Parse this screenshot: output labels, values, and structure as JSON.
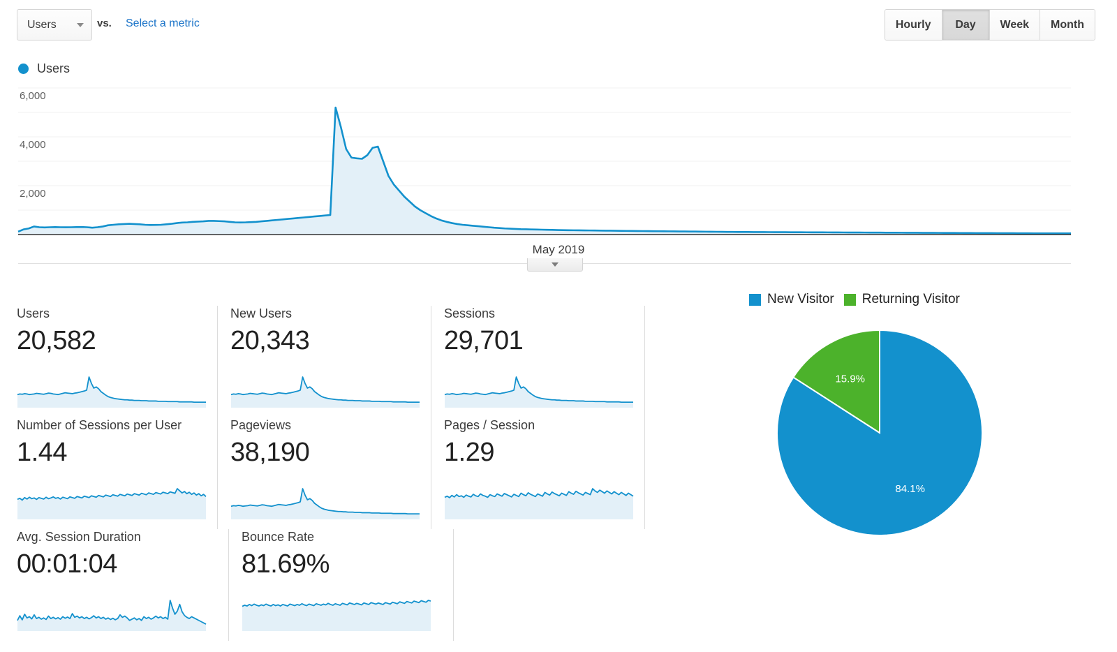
{
  "toolbar": {
    "metric_select_value": "Users",
    "metric_select_icon": "chevron-down-icon",
    "vs_label": "vs.",
    "select_metric_link": "Select a metric",
    "granularity_options": [
      "Hourly",
      "Day",
      "Week",
      "Month"
    ],
    "granularity_active": "Day"
  },
  "chart_legend": {
    "series_name": "Users",
    "dot_color": "#1391cd"
  },
  "chart_axis": {
    "x_label": "May 2019",
    "collapse_icon": "chevron-down-icon"
  },
  "cards": [
    [
      {
        "title": "Users",
        "value": "20,582",
        "fill": true
      },
      {
        "title": "New Users",
        "value": "20,343",
        "fill": true
      },
      {
        "title": "Sessions",
        "value": "29,701",
        "fill": true
      }
    ],
    [
      {
        "title": "Number of Sessions per User",
        "value": "1.44",
        "fill": true
      },
      {
        "title": "Pageviews",
        "value": "38,190",
        "fill": true
      },
      {
        "title": "Pages / Session",
        "value": "1.29",
        "fill": true
      }
    ],
    [
      {
        "title": "Avg. Session Duration",
        "value": "00:01:04",
        "fill": true
      },
      {
        "title": "Bounce Rate",
        "value": "81.69%",
        "fill": true
      }
    ]
  ],
  "pie": {
    "legend": [
      {
        "label": "New Visitor",
        "color": "#1391cd"
      },
      {
        "label": "Returning Visitor",
        "color": "#4cb22b"
      }
    ]
  },
  "colors": {
    "line": "#1391cd",
    "area": "#e3f0f8",
    "blue": "#1391cd",
    "green": "#4cb22b",
    "link": "#1a73c8",
    "grid": "#f0f0f0",
    "axis": "#333333"
  },
  "chart_data": [
    {
      "type": "area",
      "title": "Users",
      "xlabel": "May 2019",
      "ylabel": "Users",
      "ylim": [
        0,
        6000
      ],
      "yticks": [
        2000,
        4000,
        6000
      ],
      "ytick_labels": [
        "2,000",
        "4,000",
        "6,000"
      ],
      "grid": true,
      "legend": "Users",
      "series": [
        {
          "name": "Users",
          "values": [
            120,
            210,
            250,
            330,
            300,
            290,
            300,
            305,
            300,
            298,
            300,
            305,
            310,
            300,
            280,
            300,
            330,
            380,
            400,
            420,
            430,
            440,
            430,
            420,
            400,
            390,
            395,
            400,
            420,
            440,
            470,
            490,
            500,
            520,
            530,
            540,
            560,
            560,
            550,
            540,
            520,
            500,
            495,
            500,
            510,
            520,
            540,
            560,
            580,
            600,
            620,
            640,
            660,
            680,
            700,
            720,
            740,
            760,
            780,
            800,
            5200,
            4400,
            3500,
            3150,
            3120,
            3100,
            3250,
            3550,
            3600,
            3000,
            2400,
            2050,
            1800,
            1550,
            1350,
            1150,
            1000,
            880,
            760,
            660,
            580,
            520,
            470,
            430,
            400,
            380,
            360,
            340,
            320,
            300,
            280,
            265,
            250,
            240,
            230,
            220,
            215,
            210,
            205,
            200,
            195,
            190,
            185,
            180,
            178,
            175,
            172,
            170,
            168,
            165,
            162,
            160,
            158,
            155,
            152,
            150,
            148,
            145,
            143,
            140,
            138,
            136,
            134,
            132,
            130,
            128,
            126,
            124,
            122,
            120,
            118,
            116,
            114,
            112,
            110,
            108,
            106,
            105,
            104,
            103,
            102,
            101,
            100,
            99,
            98,
            97,
            96,
            95,
            94,
            93,
            92,
            91,
            90,
            89,
            88,
            87,
            86,
            85,
            84,
            83,
            82,
            81,
            80,
            79,
            78,
            77,
            76,
            75,
            74,
            73,
            72,
            71,
            70,
            69,
            68,
            67,
            66,
            65,
            64,
            63,
            62,
            61,
            60,
            59,
            58,
            57,
            56,
            55,
            54,
            53,
            52,
            51,
            50,
            50,
            49,
            49,
            48,
            48,
            47,
            47
          ]
        }
      ]
    },
    {
      "type": "pie",
      "title": "New vs Returning Visitors",
      "labels": [
        "New Visitor",
        "Returning Visitor"
      ],
      "values": [
        84.1,
        15.9
      ],
      "value_labels": [
        "84.1%",
        "15.9%"
      ],
      "colors": [
        "#1391cd",
        "#4cb22b"
      ],
      "legend_position": "top",
      "start_angle_deg": -90,
      "direction": "counterclockwise"
    }
  ],
  "sparklines": {
    "peak": [
      40,
      42,
      41,
      43,
      42,
      40,
      41,
      42,
      44,
      43,
      42,
      41,
      43,
      45,
      44,
      42,
      41,
      40,
      42,
      44,
      46,
      45,
      44,
      43,
      45,
      46,
      48,
      50,
      52,
      55,
      100,
      78,
      62,
      66,
      60,
      50,
      44,
      38,
      33,
      30,
      28,
      26,
      25,
      24,
      23,
      22,
      22,
      21,
      21,
      20,
      20,
      20,
      19,
      19,
      19,
      18,
      18,
      18,
      18,
      17,
      17,
      17,
      17,
      16,
      16,
      16,
      16,
      16,
      15,
      15,
      15,
      15,
      15,
      15,
      14,
      14,
      14,
      14,
      14,
      14
    ],
    "flat_noisy": [
      52,
      55,
      50,
      57,
      53,
      58,
      54,
      56,
      52,
      57,
      55,
      53,
      58,
      54,
      56,
      59,
      55,
      57,
      53,
      58,
      56,
      54,
      59,
      57,
      55,
      60,
      58,
      56,
      61,
      59,
      57,
      62,
      60,
      58,
      63,
      61,
      59,
      64,
      62,
      60,
      65,
      63,
      61,
      66,
      64,
      62,
      67,
      65,
      63,
      68,
      66,
      64,
      69,
      67,
      65,
      70,
      68,
      66,
      71,
      69,
      67,
      72,
      70,
      68,
      73,
      71,
      69,
      82,
      76,
      70,
      74,
      68,
      72,
      66,
      70,
      64,
      68,
      62,
      66,
      60
    ],
    "flat_wavy": [
      55,
      58,
      54,
      60,
      56,
      62,
      57,
      59,
      55,
      61,
      58,
      56,
      63,
      59,
      57,
      64,
      60,
      58,
      55,
      62,
      59,
      57,
      64,
      61,
      58,
      65,
      62,
      59,
      56,
      63,
      60,
      57,
      66,
      62,
      59,
      67,
      63,
      60,
      57,
      64,
      61,
      58,
      68,
      64,
      61,
      69,
      65,
      62,
      59,
      66,
      63,
      60,
      70,
      66,
      63,
      71,
      67,
      64,
      61,
      68,
      65,
      62,
      78,
      72,
      68,
      74,
      70,
      66,
      72,
      68,
      64,
      70,
      66,
      62,
      68,
      64,
      60,
      66,
      62,
      58
    ],
    "spiky": [
      30,
      45,
      32,
      50,
      38,
      42,
      35,
      48,
      36,
      40,
      34,
      38,
      33,
      44,
      36,
      40,
      35,
      39,
      34,
      42,
      37,
      41,
      36,
      52,
      40,
      44,
      38,
      42,
      36,
      40,
      35,
      39,
      45,
      38,
      42,
      36,
      40,
      34,
      38,
      33,
      37,
      32,
      36,
      48,
      40,
      44,
      38,
      30,
      34,
      38,
      32,
      36,
      30,
      42,
      36,
      40,
      34,
      38,
      44,
      38,
      42,
      36,
      40,
      34,
      95,
      70,
      50,
      60,
      82,
      58,
      46,
      40,
      36,
      42,
      38,
      34,
      30,
      26,
      22,
      18
    ],
    "bounce": [
      62,
      65,
      63,
      67,
      64,
      68,
      65,
      63,
      66,
      64,
      68,
      65,
      63,
      67,
      64,
      66,
      63,
      67,
      65,
      63,
      68,
      66,
      64,
      67,
      65,
      69,
      66,
      64,
      68,
      66,
      64,
      69,
      67,
      65,
      68,
      66,
      70,
      67,
      65,
      69,
      67,
      65,
      70,
      68,
      66,
      71,
      69,
      67,
      70,
      68,
      66,
      71,
      69,
      67,
      72,
      70,
      68,
      71,
      69,
      67,
      72,
      70,
      68,
      73,
      71,
      69,
      74,
      72,
      70,
      75,
      73,
      71,
      76,
      74,
      72,
      77,
      75,
      73,
      78,
      76
    ]
  }
}
